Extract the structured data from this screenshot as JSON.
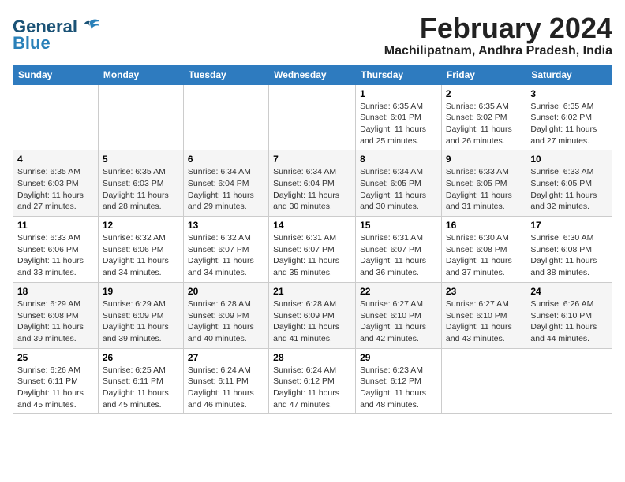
{
  "logo": {
    "text_general": "General",
    "text_blue": "Blue"
  },
  "title": "February 2024",
  "location": "Machilipatnam, Andhra Pradesh, India",
  "weekdays": [
    "Sunday",
    "Monday",
    "Tuesday",
    "Wednesday",
    "Thursday",
    "Friday",
    "Saturday"
  ],
  "weeks": [
    [
      {
        "day": "",
        "info": ""
      },
      {
        "day": "",
        "info": ""
      },
      {
        "day": "",
        "info": ""
      },
      {
        "day": "",
        "info": ""
      },
      {
        "day": "1",
        "info": "Sunrise: 6:35 AM\nSunset: 6:01 PM\nDaylight: 11 hours\nand 25 minutes."
      },
      {
        "day": "2",
        "info": "Sunrise: 6:35 AM\nSunset: 6:02 PM\nDaylight: 11 hours\nand 26 minutes."
      },
      {
        "day": "3",
        "info": "Sunrise: 6:35 AM\nSunset: 6:02 PM\nDaylight: 11 hours\nand 27 minutes."
      }
    ],
    [
      {
        "day": "4",
        "info": "Sunrise: 6:35 AM\nSunset: 6:03 PM\nDaylight: 11 hours\nand 27 minutes."
      },
      {
        "day": "5",
        "info": "Sunrise: 6:35 AM\nSunset: 6:03 PM\nDaylight: 11 hours\nand 28 minutes."
      },
      {
        "day": "6",
        "info": "Sunrise: 6:34 AM\nSunset: 6:04 PM\nDaylight: 11 hours\nand 29 minutes."
      },
      {
        "day": "7",
        "info": "Sunrise: 6:34 AM\nSunset: 6:04 PM\nDaylight: 11 hours\nand 30 minutes."
      },
      {
        "day": "8",
        "info": "Sunrise: 6:34 AM\nSunset: 6:05 PM\nDaylight: 11 hours\nand 30 minutes."
      },
      {
        "day": "9",
        "info": "Sunrise: 6:33 AM\nSunset: 6:05 PM\nDaylight: 11 hours\nand 31 minutes."
      },
      {
        "day": "10",
        "info": "Sunrise: 6:33 AM\nSunset: 6:05 PM\nDaylight: 11 hours\nand 32 minutes."
      }
    ],
    [
      {
        "day": "11",
        "info": "Sunrise: 6:33 AM\nSunset: 6:06 PM\nDaylight: 11 hours\nand 33 minutes."
      },
      {
        "day": "12",
        "info": "Sunrise: 6:32 AM\nSunset: 6:06 PM\nDaylight: 11 hours\nand 34 minutes."
      },
      {
        "day": "13",
        "info": "Sunrise: 6:32 AM\nSunset: 6:07 PM\nDaylight: 11 hours\nand 34 minutes."
      },
      {
        "day": "14",
        "info": "Sunrise: 6:31 AM\nSunset: 6:07 PM\nDaylight: 11 hours\nand 35 minutes."
      },
      {
        "day": "15",
        "info": "Sunrise: 6:31 AM\nSunset: 6:07 PM\nDaylight: 11 hours\nand 36 minutes."
      },
      {
        "day": "16",
        "info": "Sunrise: 6:30 AM\nSunset: 6:08 PM\nDaylight: 11 hours\nand 37 minutes."
      },
      {
        "day": "17",
        "info": "Sunrise: 6:30 AM\nSunset: 6:08 PM\nDaylight: 11 hours\nand 38 minutes."
      }
    ],
    [
      {
        "day": "18",
        "info": "Sunrise: 6:29 AM\nSunset: 6:08 PM\nDaylight: 11 hours\nand 39 minutes."
      },
      {
        "day": "19",
        "info": "Sunrise: 6:29 AM\nSunset: 6:09 PM\nDaylight: 11 hours\nand 39 minutes."
      },
      {
        "day": "20",
        "info": "Sunrise: 6:28 AM\nSunset: 6:09 PM\nDaylight: 11 hours\nand 40 minutes."
      },
      {
        "day": "21",
        "info": "Sunrise: 6:28 AM\nSunset: 6:09 PM\nDaylight: 11 hours\nand 41 minutes."
      },
      {
        "day": "22",
        "info": "Sunrise: 6:27 AM\nSunset: 6:10 PM\nDaylight: 11 hours\nand 42 minutes."
      },
      {
        "day": "23",
        "info": "Sunrise: 6:27 AM\nSunset: 6:10 PM\nDaylight: 11 hours\nand 43 minutes."
      },
      {
        "day": "24",
        "info": "Sunrise: 6:26 AM\nSunset: 6:10 PM\nDaylight: 11 hours\nand 44 minutes."
      }
    ],
    [
      {
        "day": "25",
        "info": "Sunrise: 6:26 AM\nSunset: 6:11 PM\nDaylight: 11 hours\nand 45 minutes."
      },
      {
        "day": "26",
        "info": "Sunrise: 6:25 AM\nSunset: 6:11 PM\nDaylight: 11 hours\nand 45 minutes."
      },
      {
        "day": "27",
        "info": "Sunrise: 6:24 AM\nSunset: 6:11 PM\nDaylight: 11 hours\nand 46 minutes."
      },
      {
        "day": "28",
        "info": "Sunrise: 6:24 AM\nSunset: 6:12 PM\nDaylight: 11 hours\nand 47 minutes."
      },
      {
        "day": "29",
        "info": "Sunrise: 6:23 AM\nSunset: 6:12 PM\nDaylight: 11 hours\nand 48 minutes."
      },
      {
        "day": "",
        "info": ""
      },
      {
        "day": "",
        "info": ""
      }
    ]
  ]
}
